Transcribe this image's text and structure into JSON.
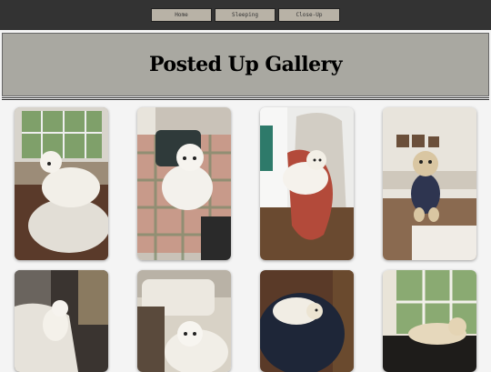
{
  "nav": {
    "items": [
      {
        "label": "Home"
      },
      {
        "label": "Sleeping"
      },
      {
        "label": "Close-Up"
      }
    ]
  },
  "header": {
    "title": "Posted Up Gallery"
  },
  "gallery": {
    "photos": [
      {
        "subject": "white dog standing on sofa by window"
      },
      {
        "subject": "white dog sitting on plaid armchair"
      },
      {
        "subject": "white dog lying on grey chair with red blanket"
      },
      {
        "subject": "golden dog in navy sweater on ottoman"
      },
      {
        "subject": "white dog on sofa in dark room"
      },
      {
        "subject": "white dog on cream sofa"
      },
      {
        "subject": "white dog lying on dark bean bag"
      },
      {
        "subject": "golden dog lying on leather chair by window"
      }
    ]
  }
}
